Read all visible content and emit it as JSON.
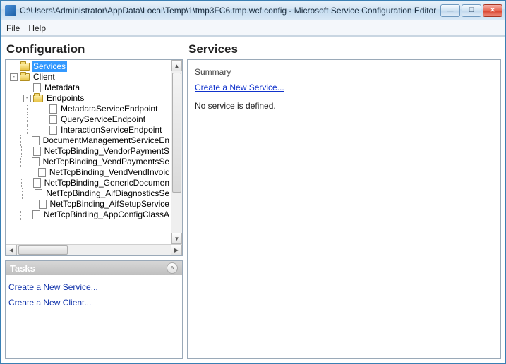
{
  "window": {
    "title": "C:\\Users\\Administrator\\AppData\\Local\\Temp\\1\\tmp3FC6.tmp.wcf.config - Microsoft Service Configuration Editor"
  },
  "menu": {
    "file": "File",
    "help": "Help"
  },
  "config_panel": {
    "title": "Configuration",
    "tree": {
      "services": "Services",
      "client": "Client",
      "metadata": "Metadata",
      "endpoints": "Endpoints",
      "endpoint_items": [
        "MetadataServiceEndpoint",
        "QueryServiceEndpoint",
        "InteractionServiceEndpoint",
        "DocumentManagementServiceEn",
        "NetTcpBinding_VendorPaymentS",
        "NetTcpBinding_VendPaymentsSe",
        "NetTcpBinding_VendVendInvoic",
        "NetTcpBinding_GenericDocumen",
        "NetTcpBinding_AifDiagnosticsSe",
        "NetTcpBinding_AifSetupService",
        "NetTcpBinding_AppConfigClassA"
      ]
    }
  },
  "tasks_panel": {
    "title": "Tasks",
    "links": {
      "new_service": "Create a New Service...",
      "new_client": "Create a New Client..."
    }
  },
  "services_panel": {
    "title": "Services",
    "summary_label": "Summary",
    "create_link": "Create a New Service...",
    "empty_text": "No service is defined."
  }
}
